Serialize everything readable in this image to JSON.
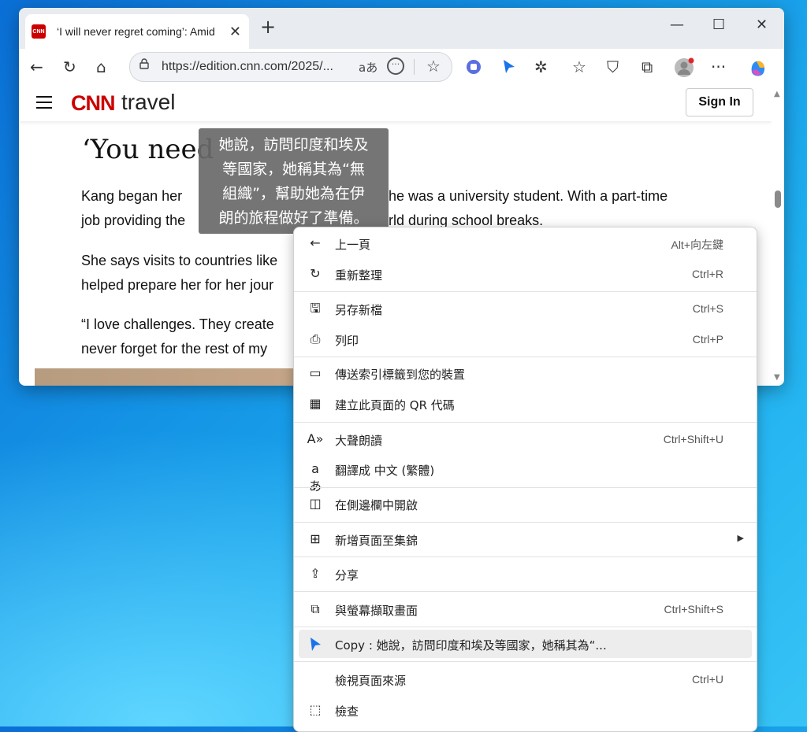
{
  "browser": {
    "tab_title": "‘I will never regret coming’: Amid",
    "favicon_text": "CNN",
    "url": "https://edition.cnn.com/2025/...",
    "read_aloud_glyph": "aあ"
  },
  "page": {
    "logo_text": "CNN",
    "section": "travel",
    "signin_label": "Sign In",
    "headline": "‘You need",
    "para1_line1": "Kang began her",
    "para1_line1_right": "he was a university student. With a part-time",
    "para1_line2": "job providing the",
    "para1_line2_right": "rld during school breaks.",
    "para2_line1": "She says visits to countries like",
    "para2_line2": "helped prepare her for her jour",
    "para3_line1": "“I love challenges. They create",
    "para3_line2": "never forget for the rest of my"
  },
  "tooltip": {
    "lines": [
      "她說，訪問印度和埃及",
      "等國家，她稱其為“無",
      "組織”，幫助她為在伊",
      "朗的旅程做好了準備。"
    ]
  },
  "menu": {
    "back": {
      "label": "上一頁",
      "shortcut": "Alt+向左鍵"
    },
    "refresh": {
      "label": "重新整理",
      "shortcut": "Ctrl+R"
    },
    "save": {
      "label": "另存新檔",
      "shortcut": "Ctrl+S"
    },
    "print": {
      "label": "列印",
      "shortcut": "Ctrl+P"
    },
    "send_tab": {
      "label": "傳送索引標籤到您的裝置"
    },
    "qr": {
      "label": "建立此頁面的 QR 代碼"
    },
    "read_aloud": {
      "label": "大聲朗讀",
      "shortcut": "Ctrl+Shift+U"
    },
    "translate": {
      "label": "翻譯成 中文 (繁體)"
    },
    "sidebar": {
      "label": "在側邊欄中開啟"
    },
    "collections": {
      "label": "新增頁面至集錦"
    },
    "share": {
      "label": "分享"
    },
    "screenshot": {
      "label": "與螢幕擷取畫面",
      "shortcut": "Ctrl+Shift+S"
    },
    "copy": {
      "label": "Copy : 她說，訪問印度和埃及等國家，她稱其為“..."
    },
    "view_source": {
      "label": "檢視頁面來源",
      "shortcut": "Ctrl+U"
    },
    "inspect": {
      "label": "檢查"
    }
  },
  "colors": {
    "cnn_red": "#cc0000",
    "copilot_pointer": "#1a73e8"
  }
}
